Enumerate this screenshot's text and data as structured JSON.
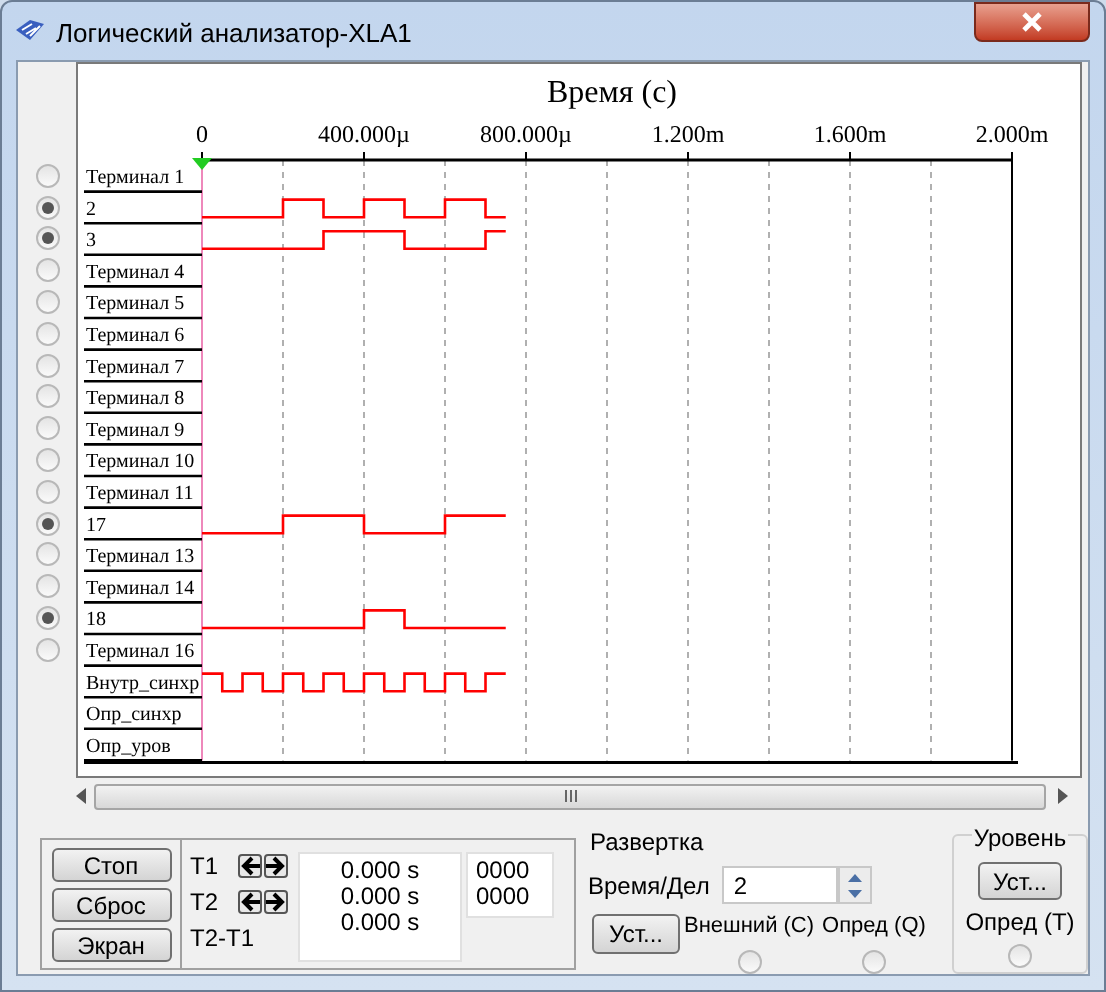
{
  "window": {
    "title": "Логический анализатор-XLA1"
  },
  "axis": {
    "title": "Время (с)",
    "ticks": [
      "0",
      "400.000µ",
      "800.000µ",
      "1.200m",
      "1.600m",
      "2.000m"
    ]
  },
  "channels": [
    {
      "kind": "terminal",
      "label": "Терминал 1",
      "selected": false,
      "trace": false
    },
    {
      "kind": "terminal",
      "label": "2",
      "selected": true,
      "trace": true
    },
    {
      "kind": "terminal",
      "label": "3",
      "selected": true,
      "trace": true
    },
    {
      "kind": "terminal",
      "label": "Терминал 4",
      "selected": false,
      "trace": false
    },
    {
      "kind": "terminal",
      "label": "Терминал 5",
      "selected": false,
      "trace": false
    },
    {
      "kind": "terminal",
      "label": "Терминал 6",
      "selected": false,
      "trace": false
    },
    {
      "kind": "terminal",
      "label": "Терминал 7",
      "selected": false,
      "trace": false
    },
    {
      "kind": "terminal",
      "label": "Терминал 8",
      "selected": false,
      "trace": false
    },
    {
      "kind": "terminal",
      "label": "Терминал 9",
      "selected": false,
      "trace": false
    },
    {
      "kind": "terminal",
      "label": "Терминал 10",
      "selected": false,
      "trace": false
    },
    {
      "kind": "terminal",
      "label": "Терминал 11",
      "selected": false,
      "trace": false
    },
    {
      "kind": "terminal",
      "label": "17",
      "selected": true,
      "trace": true
    },
    {
      "kind": "terminal",
      "label": "Терминал 13",
      "selected": false,
      "trace": false
    },
    {
      "kind": "terminal",
      "label": "Терминал 14",
      "selected": false,
      "trace": false
    },
    {
      "kind": "terminal",
      "label": "18",
      "selected": true,
      "trace": true
    },
    {
      "kind": "terminal",
      "label": "Терминал 16",
      "selected": false,
      "trace": false
    },
    {
      "kind": "trigger",
      "label": "Внутр_синхр",
      "trace": true
    },
    {
      "kind": "trigger",
      "label": "Опр_синхр",
      "trace": false
    },
    {
      "kind": "trigger",
      "label": "Опр_уров",
      "trace": false
    }
  ],
  "controls": {
    "buttons": [
      "Стоп",
      "Сброс",
      "Экран"
    ]
  },
  "cursors": {
    "rows": [
      {
        "label": "T1",
        "time": "0.000 s",
        "count": "0000"
      },
      {
        "label": "T2",
        "time": "0.000 s",
        "count": "0000"
      },
      {
        "label": "T2-T1",
        "time": "0.000 s"
      }
    ]
  },
  "sweep": {
    "title": "Развертка",
    "time_label": "Время/Дел",
    "time_value": "2",
    "set_button": "Уст...",
    "options": [
      {
        "label": "Внешний (С)",
        "selected": false
      },
      {
        "label": "Опред (Q)",
        "selected": false
      }
    ]
  },
  "level": {
    "title": "Уровень",
    "set_button": "Уст...",
    "option": {
      "label": "Опред (T)",
      "selected": false
    }
  }
}
